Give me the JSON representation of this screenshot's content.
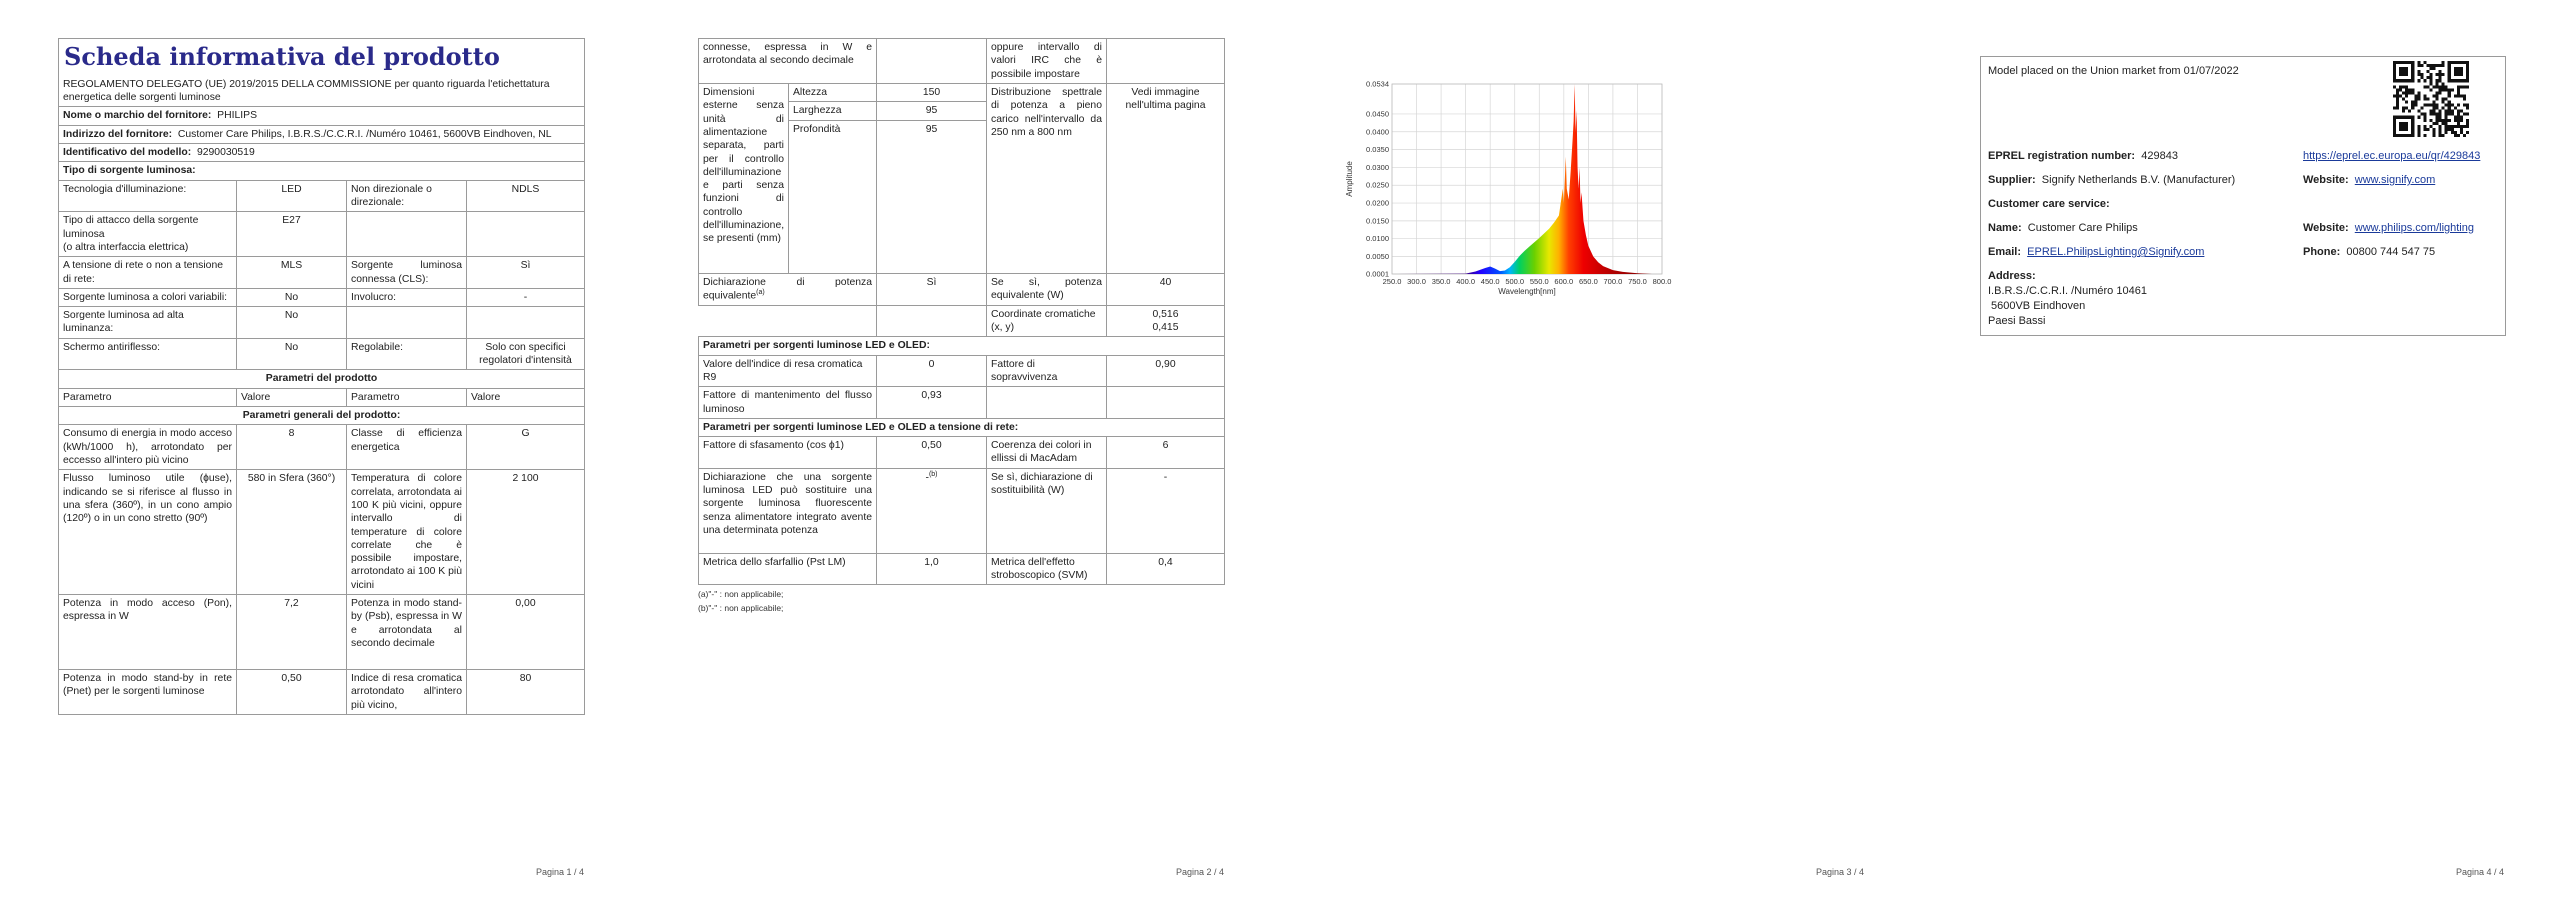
{
  "page1": {
    "title": "Scheda informativa del prodotto",
    "regulation": "REGOLAMENTO DELEGATO (UE) 2019/2015 DELLA COMMISSIONE per quanto riguarda l'etichettatura energetica delle sorgenti luminose",
    "supplier_label": "Nome o marchio del fornitore:",
    "supplier_value": "PHILIPS",
    "address_label": "Indirizzo del fornitore:",
    "address_value": "Customer Care Philips, I.B.R.S./C.C.R.I. /Numéro 10461, 5600VB Eindhoven, NL",
    "model_label": "Identificativo del modello:",
    "model_value": "9290030519",
    "source_type_heading": "Tipo di sorgente luminosa:",
    "tech_label": "Tecnologia d'illuminazione:",
    "tech_value": "LED",
    "nondir_label": "Non direzionale o direzionale:",
    "nondir_value": "NDLS",
    "cap_label": "Tipo di attacco della sorgente luminosa",
    "cap_label2": "(o altra interfaccia elettrica)",
    "cap_value": "E27",
    "mains_label": "A tensione di rete o non a tensione di rete:",
    "mains_value": "MLS",
    "cls_label": "Sorgente luminosa connessa (CLS):",
    "cls_value": "Sì",
    "tunable_label": "Sorgente luminosa a colori variabili:",
    "tunable_value": "No",
    "envelope_label": "Involucro:",
    "envelope_value": "-",
    "hilum_label": "Sorgente luminosa ad alta luminanza:",
    "hilum_value": "No",
    "antiglare_label": "Schermo antiriflesso:",
    "antiglare_value": "No",
    "dimmable_label": "Regolabile:",
    "dimmable_value": "Solo con specifici regolatori d'intensità",
    "params_heading": "Parametri del prodotto",
    "col_param": "Parametro",
    "col_value": "Valore",
    "general_heading": "Parametri generali del prodotto:",
    "energy_label": "Consumo di energia in modo acceso (kWh/1000 h), arrotondato per eccesso all'intero più vicino",
    "energy_value": "8",
    "eclass_label": "Classe di efficienza energetica",
    "eclass_value": "G",
    "flux_label": "Flusso luminoso utile (ɸuse), indicando se si riferisce al flusso in una sfera (360º), in un cono ampio (120º) o in un cono stretto (90º)",
    "flux_value": "580 in Sfera (360°)",
    "cct_label": "Temperatura di colore correlata, arrotondata ai 100 K più vicini, oppure intervallo di temperature di colore correlate che è possibile impostare, arrotondato ai 100 K più vicini",
    "cct_value": "2 100",
    "pon_label": "Potenza in modo acceso (Pon), espressa in W",
    "pon_value": "7,2",
    "psb_label": "Potenza in modo stand-by (Psb), espressa in W e arrotondata al secondo decimale",
    "psb_value": "0,00",
    "pnet_label": "Potenza in modo stand-by in rete (Pnet) per le sorgenti luminose",
    "pnet_value": "0,50",
    "cri_label": "Indice di resa cromatica arrotondato all'intero più vicino,",
    "cri_value": "80",
    "page_number": "Pagina 1 / 4"
  },
  "page2": {
    "cont_left": "connesse, espressa in W e arrotondata al secondo decimale",
    "cont_right": "oppure intervallo di valori IRC che è possibile impostare",
    "dims_label": "Dimensioni esterne senza unità di alimentazione separata, parti per il controllo dell'illuminazione e parti senza funzioni di controllo dell'illuminazione, se presenti (mm)",
    "height_label": "Altezza",
    "height_value": "150",
    "width_label": "Larghezza",
    "width_value": "95",
    "depth_label": "Profondità",
    "depth_value": "95",
    "spd_label": "Distribuzione spettrale di potenza a pieno carico nell'intervallo da 250 nm a 800 nm",
    "spd_value": "Vedi immagine nell'ultima pagina",
    "eqpower_label": "Dichiarazione di potenza equivalente",
    "eqpower_sup": "(a)",
    "eqpower_value": "Sì",
    "eqpower_w_label": "Se sì, potenza equivalente (W)",
    "eqpower_w_value": "40",
    "chroma_label": "Coordinate cromatiche (x, y)",
    "chroma_x": "0,516",
    "chroma_y": "0,415",
    "led_heading": "Parametri per sorgenti luminose LED e OLED:",
    "r9_label": "Valore dell'indice di resa cromatica R9",
    "r9_value": "0",
    "survival_label": "Fattore di sopravvivenza",
    "survival_value": "0,90",
    "maint_label": "Fattore di mantenimento del flusso luminoso",
    "maint_value": "0,93",
    "mains_heading": "Parametri per sorgenti luminose LED e OLED a tensione di rete:",
    "phase_label": "Fattore di sfasamento (cos ϕ1)",
    "phase_value": "0,50",
    "macadam_label": "Coerenza dei colori in ellissi di MacAdam",
    "macadam_value": "6",
    "replace_label": "Dichiarazione che una sorgente luminosa LED può sostituire una sorgente luminosa fluorescente senza alimentatore integrato avente una determinata potenza",
    "replace_value": "-",
    "replace_sup": "(b)",
    "replace_w_label": "Se sì, dichiarazione di sostituibilità (W)",
    "replace_w_value": "-",
    "flicker_label": "Metrica dello sfarfallio (Pst LM)",
    "flicker_value": "1,0",
    "svm_label": "Metrica dell'effetto stroboscopico (SVM)",
    "svm_value": "0,4",
    "note_a": "(a)\"-\" : non applicabile;",
    "note_b": "(b)\"-\" : non applicabile;",
    "page_number": "Pagina 2 / 4"
  },
  "page3": {
    "page_number": "Pagina 3 / 4"
  },
  "page4": {
    "placed": "Model placed on the Union market from 01/07/2022",
    "eprel_label": "EPREL registration number:",
    "eprel_value": "429843",
    "eprel_url": "https://eprel.ec.europa.eu/qr/429843",
    "supplier_label": "Supplier:",
    "supplier_value": "Signify Netherlands B.V. (Manufacturer)",
    "website_label": "Website:",
    "website_value": "www.signify.com",
    "care_heading": "Customer care service:",
    "name_label": "Name:",
    "name_value": "Customer Care Philips",
    "website2_label": "Website:",
    "website2_value": "www.philips.com/lighting",
    "email_label": "Email:",
    "email_value": "EPREL.PhilipsLighting@Signify.com",
    "phone_label": "Phone:",
    "phone_value": "00800 744 547 75",
    "address_label": "Address:",
    "address_line1": "I.B.R.S./C.C.R.I. /Numéro 10461",
    "address_line2": "5600VB Eindhoven",
    "address_line3": "Paesi Bassi",
    "qr_icon": "qr-code-icon",
    "page_number": "Pagina 4 / 4"
  },
  "chart_data": {
    "type": "area",
    "title": "",
    "xlabel": "Wavelength[nm]",
    "ylabel": "Amplitude",
    "xlim": [
      250,
      800
    ],
    "ylim": [
      0.0001,
      0.0534
    ],
    "xticks": [
      "250.0",
      "300.0",
      "350.0",
      "400.0",
      "450.0",
      "500.0",
      "550.0",
      "600.0",
      "650.0",
      "700.0",
      "750.0",
      "800.0"
    ],
    "yticks": [
      "0.0001",
      "0.0050",
      "0.0100",
      "0.0150",
      "0.0200",
      "0.0250",
      "0.0300",
      "0.0350",
      "0.0400",
      "0.0450",
      "0.0534"
    ],
    "grid": true,
    "fill": "visible-spectrum gradient",
    "series": [
      {
        "x": [
          250,
          400,
          420,
          440,
          450,
          460,
          470,
          480,
          490,
          500,
          510,
          520,
          530,
          540,
          550,
          560,
          570,
          580,
          590,
          598,
          600,
          604,
          606,
          610,
          614,
          618,
          620,
          622,
          624,
          626,
          628,
          630,
          632,
          634,
          636,
          640,
          645,
          650,
          660,
          670,
          680,
          700,
          720,
          750,
          780,
          800
        ],
        "y": [
          0.0001,
          0.0002,
          0.0008,
          0.0018,
          0.0022,
          0.0016,
          0.0009,
          0.0011,
          0.002,
          0.0035,
          0.0052,
          0.0066,
          0.0078,
          0.009,
          0.0102,
          0.0115,
          0.0128,
          0.0145,
          0.0165,
          0.024,
          0.02,
          0.033,
          0.024,
          0.021,
          0.029,
          0.038,
          0.043,
          0.0534,
          0.04,
          0.046,
          0.03,
          0.024,
          0.03,
          0.02,
          0.023,
          0.015,
          0.011,
          0.008,
          0.005,
          0.0034,
          0.0023,
          0.0012,
          0.0007,
          0.0003,
          0.0001,
          0.0001
        ]
      }
    ]
  }
}
